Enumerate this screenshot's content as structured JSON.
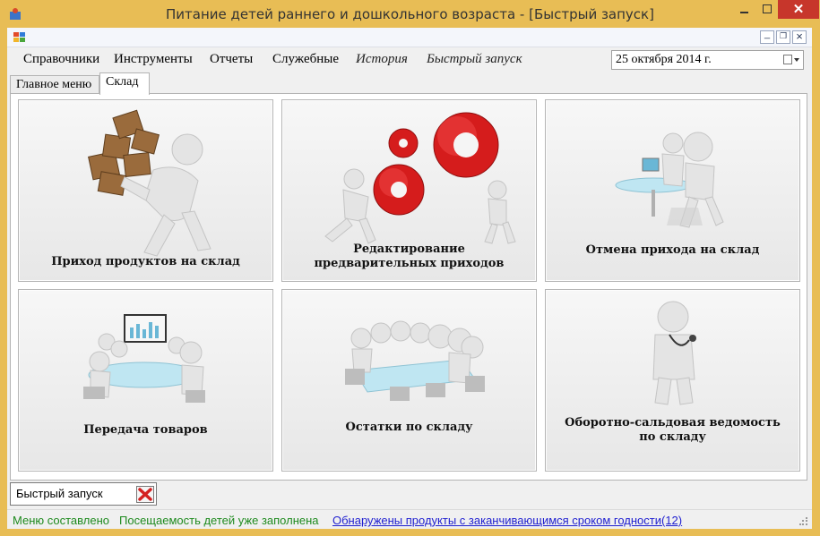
{
  "window": {
    "title": "Питание детей раннего и дошкольного возраста - [Быстрый запуск]",
    "accent": "#e8bd55",
    "close_color": "#c7362b"
  },
  "menu": {
    "items": [
      "Справочники",
      "Инструменты",
      "Отчеты",
      "Служебные",
      "История",
      "Быстрый запуск"
    ]
  },
  "date_picker": {
    "value": "25  октября  2014 г."
  },
  "tabs": [
    "Главное меню",
    "Склад"
  ],
  "active_tab": "Склад",
  "tiles": [
    {
      "label": "Приход продуктов на склад",
      "icon": "carrying-boxes-icon"
    },
    {
      "label": "Редактирование предварительных приходов",
      "icon": "gears-icon"
    },
    {
      "label": "Отмена прихода на склад",
      "icon": "meeting-icon"
    },
    {
      "label": "Передача товаров",
      "icon": "conference-icon"
    },
    {
      "label": "Остатки по складу",
      "icon": "boardroom-icon"
    },
    {
      "label": "Оборотно-сальдовая ведомость по складу",
      "icon": "doctor-icon"
    }
  ],
  "quick_launch": {
    "label": "Быстрый запуск",
    "close_icon": "red-x-icon"
  },
  "status": {
    "menu_status": "Меню составлено",
    "attendance_status": "Посещаемость детей уже заполнена",
    "expiry_link": "Обнаружены продукты с заканчивающимся сроком годности(12)",
    "status_color": "#1e8a1e",
    "link_color": "#1f1fd0"
  }
}
